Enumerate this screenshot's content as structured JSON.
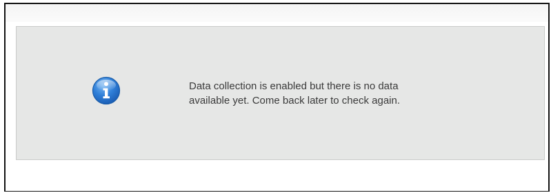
{
  "notice": {
    "icon": "info-icon",
    "colors": {
      "panel_background": "#e6e7e6",
      "icon_blue": "#2f7fd8",
      "text": "#3a3a3a"
    },
    "message_lines": [
      "Data collection is enabled but there is no data",
      "available yet. Come back later to check again."
    ]
  }
}
